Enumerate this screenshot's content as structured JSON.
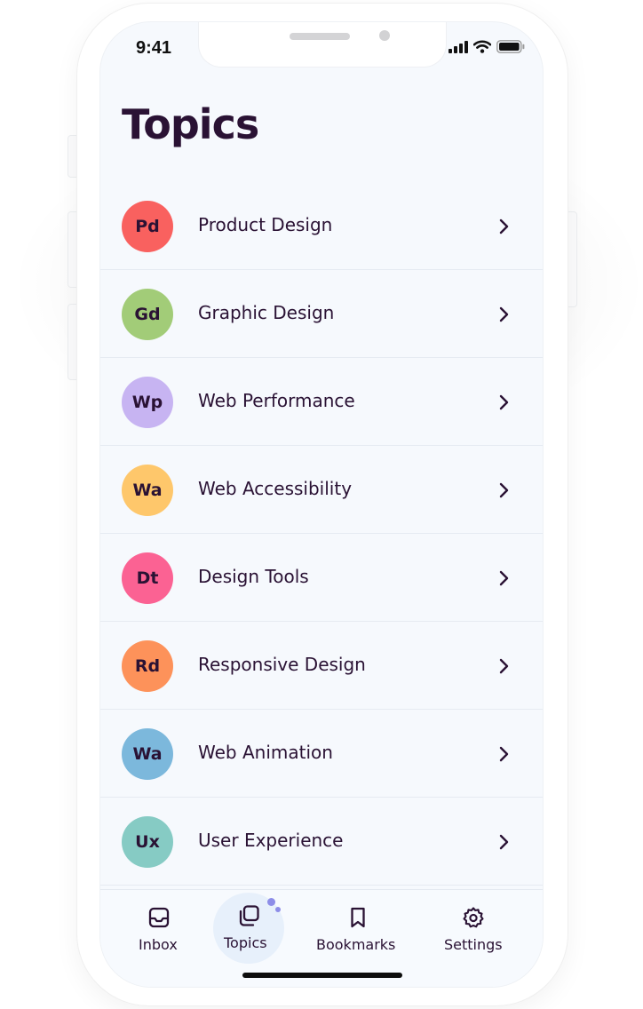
{
  "status_bar": {
    "time": "9:41",
    "icons": [
      "cellular-signal-icon",
      "wifi-icon",
      "battery-icon"
    ]
  },
  "page": {
    "title": "Topics"
  },
  "topics": [
    {
      "initials": "Pd",
      "label": "Product Design",
      "color": "#f9615f"
    },
    {
      "initials": "Gd",
      "label": "Graphic Design",
      "color": "#a2cc78"
    },
    {
      "initials": "Wp",
      "label": "Web Performance",
      "color": "#c7b4f2"
    },
    {
      "initials": "Wa",
      "label": "Web Accessibility",
      "color": "#fec76b"
    },
    {
      "initials": "Dt",
      "label": "Design Tools",
      "color": "#fb6293"
    },
    {
      "initials": "Rd",
      "label": "Responsive Design",
      "color": "#fd925a"
    },
    {
      "initials": "Wa",
      "label": "Web Animation",
      "color": "#7cb8dc"
    },
    {
      "initials": "Ux",
      "label": "User Experience",
      "color": "#86cbc4"
    }
  ],
  "tab_bar": {
    "tabs": [
      {
        "label": "Inbox",
        "icon": "inbox-icon",
        "active": false
      },
      {
        "label": "Topics",
        "icon": "topics-icon",
        "active": true
      },
      {
        "label": "Bookmarks",
        "icon": "bookmark-icon",
        "active": false
      },
      {
        "label": "Settings",
        "icon": "gear-icon",
        "active": false
      }
    ],
    "active_color": "#e7f0fb",
    "indicator_color": "#8d8de8"
  },
  "colors": {
    "text": "#2a1234",
    "screen_bg": "#f6f9fd"
  }
}
